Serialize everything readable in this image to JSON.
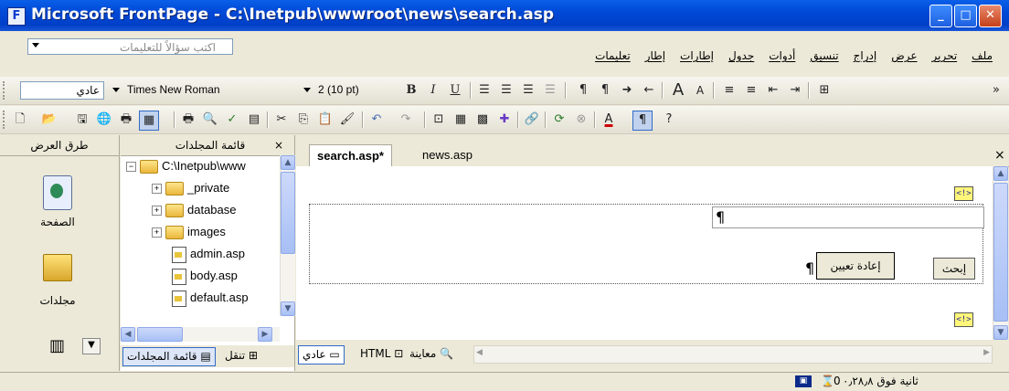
{
  "window": {
    "title": "Microsoft FrontPage - C:\\Inetpub\\wwwroot\\news\\search.asp"
  },
  "menubar": {
    "ask_placeholder": "اكتب سؤالاً للتعليمات",
    "menus": [
      "ملف",
      "تحرير",
      "عرض",
      "إدراج",
      "تنسيق",
      "أدوات",
      "جدول",
      "إطارات",
      "إطار",
      "تعليمات"
    ]
  },
  "formatting": {
    "style": "عادي",
    "font": "Times New Roman",
    "size": "2 (10 pt)"
  },
  "left_panel": {
    "header": "طرق العرض",
    "views": [
      {
        "label": "الصفحة",
        "icon": "page-view-icon"
      },
      {
        "label": "مجلدات",
        "icon": "folders-view-icon"
      }
    ]
  },
  "folder_panel": {
    "header": "قائمة المجلدات",
    "close": "×",
    "tree": [
      {
        "label": "C:\\Inetpub\\www",
        "type": "root"
      },
      {
        "label": "_private",
        "type": "folder"
      },
      {
        "label": "database",
        "type": "folder"
      },
      {
        "label": "images",
        "type": "folder"
      },
      {
        "label": "admin.asp",
        "type": "file"
      },
      {
        "label": "body.asp",
        "type": "file"
      },
      {
        "label": "default.asp",
        "type": "file"
      }
    ],
    "bottom_tab_folders": "قائمة المجلدات",
    "bottom_tab_nav": "تنقل"
  },
  "editor": {
    "tabs": [
      {
        "label": "search.asp*",
        "active": true
      },
      {
        "label": "news.asp",
        "active": false
      }
    ],
    "close": "×",
    "asp_marker": "<!>",
    "pilcrow": "¶",
    "form": {
      "search_button": "إبحث",
      "reset_button": "إعادة تعيين"
    },
    "view_tabs": [
      {
        "label": "عادي",
        "active": true
      },
      {
        "label": "HTML",
        "active": false
      },
      {
        "label": "معاينة",
        "active": false
      }
    ]
  },
  "statusbar": {
    "text": "ثانية فوق ٠٫٢٨٫٨",
    "seconds_prefix": "0"
  },
  "colors": {
    "titlebar": "#0048d6",
    "chrome": "#ece9d8",
    "asp_marker_bg": "#fff67a"
  }
}
